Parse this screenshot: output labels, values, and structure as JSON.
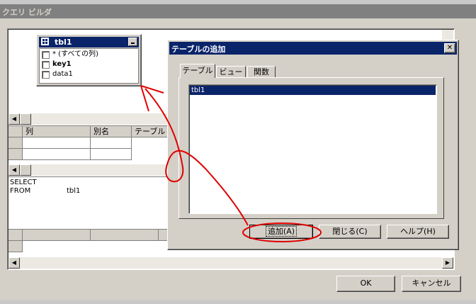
{
  "window": {
    "title": "クエリ ビルダ"
  },
  "table_box": {
    "title": "tbl1",
    "fields": [
      "* (すべての列)",
      "key1",
      "data1"
    ]
  },
  "grid": {
    "columns": [
      "列",
      "別名",
      "テーブル"
    ]
  },
  "sql": {
    "line1": "SELECT",
    "line2_keyword": "FROM",
    "line2_table": "tbl1"
  },
  "buttons": {
    "ok": "OK",
    "cancel": "キャンセル"
  },
  "dialog": {
    "title": "テーブルの追加",
    "tabs": [
      "テーブル",
      "ビュー",
      "関数"
    ],
    "items": [
      "tbl1"
    ],
    "buttons": {
      "add": "追加(A)",
      "close": "閉じる(C)",
      "help": "ヘルプ(H)"
    }
  },
  "colors": {
    "titlebar_inactive": "#808080",
    "titlebar_active": "#0a246a",
    "selection": "#0a246a",
    "annotation": "#e00000"
  }
}
